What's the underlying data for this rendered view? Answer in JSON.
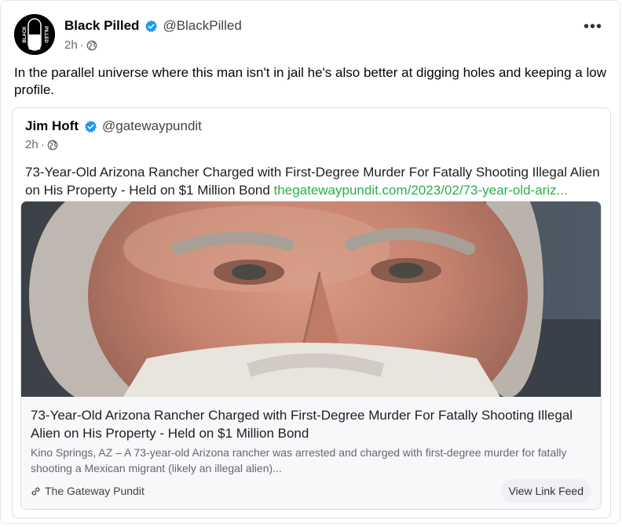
{
  "post": {
    "author_name": "Black Pilled",
    "handle": "@BlackPilled",
    "time": "2h",
    "dot": "·",
    "avatar_text": "BLACK PILLED",
    "more_label": "•••",
    "text": "In the parallel universe where this man isn't in jail he's also better at digging holes and keeping a low profile."
  },
  "quoted": {
    "author_name": "Jim Hoft",
    "handle": "@gatewaypundit",
    "time": "2h",
    "dot": "·",
    "text": "73-Year-Old Arizona Rancher Charged with First-Degree Murder For Fatally Shooting Illegal Alien on His Property - Held on $1 Million Bond",
    "link_text": "thegatewaypundit.com/2023/02/73-year-old-ariz..."
  },
  "link_card": {
    "title": "73-Year-Old Arizona Rancher Charged with First-Degree Murder For Fatally Shooting Illegal Alien on His Property - Held on $1 Million Bond",
    "description": "Kino Springs, AZ – A 73-year-old Arizona rancher was arrested and charged with first-degree murder for fatally shooting a Mexican migrant (likely an illegal alien)...",
    "source": "The Gateway Pundit",
    "view_button": "View Link Feed"
  },
  "icons": {
    "verified": "verified-badge-icon",
    "globe": "globe-icon",
    "link": "link-chain-icon",
    "more": "more-options-icon"
  },
  "colors": {
    "verified_blue": "#1d9bf0",
    "link_green": "#28b04a",
    "muted_text": "#65676b"
  }
}
